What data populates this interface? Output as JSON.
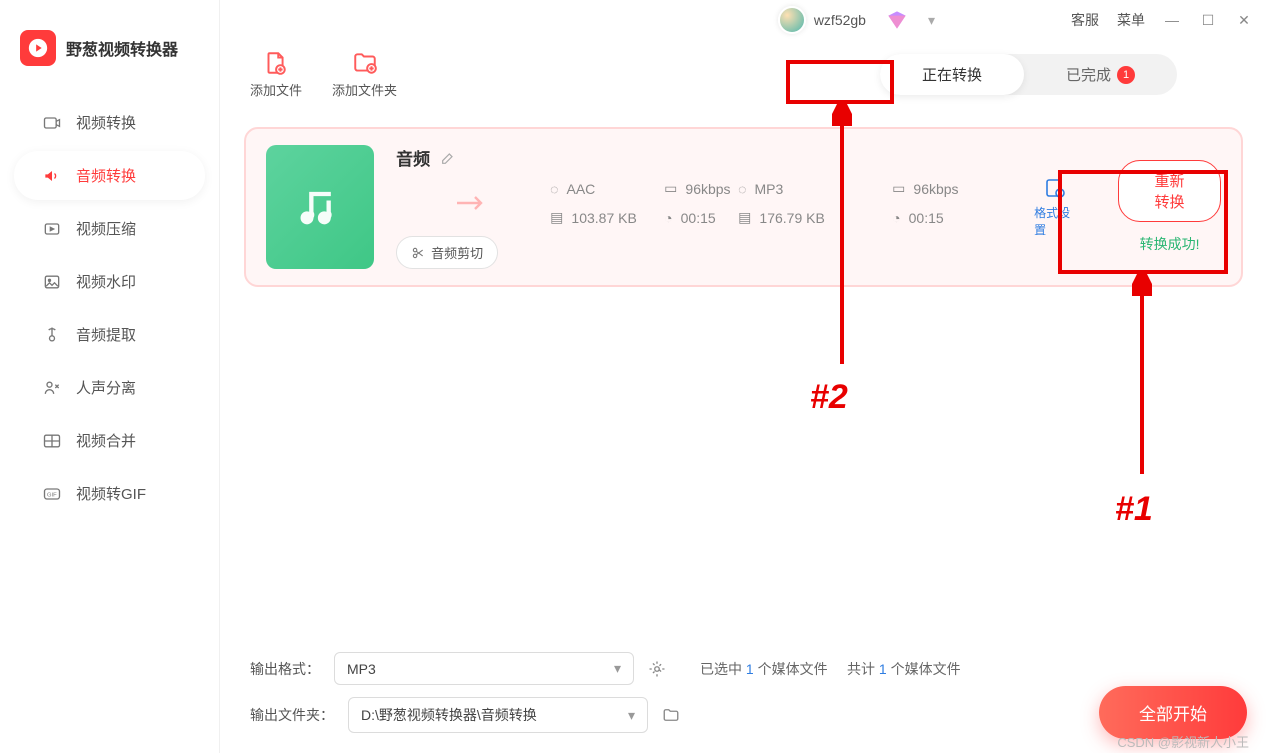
{
  "app": {
    "name": "野葱视频转换器"
  },
  "titlebar": {
    "username": "wzf52gb",
    "links": [
      "客服",
      "菜单"
    ]
  },
  "sidebar": {
    "items": [
      {
        "label": "视频转换",
        "icon": "video-convert-icon"
      },
      {
        "label": "音频转换",
        "icon": "audio-convert-icon",
        "active": true
      },
      {
        "label": "视频压缩",
        "icon": "video-compress-icon"
      },
      {
        "label": "视频水印",
        "icon": "watermark-icon"
      },
      {
        "label": "音频提取",
        "icon": "audio-extract-icon"
      },
      {
        "label": "人声分离",
        "icon": "voice-separate-icon"
      },
      {
        "label": "视频合并",
        "icon": "video-merge-icon"
      },
      {
        "label": "视频转GIF",
        "icon": "video-gif-icon"
      }
    ]
  },
  "toolbar": {
    "add_file": "添加文件",
    "add_folder": "添加文件夹",
    "tabs": {
      "converting": "正在转换",
      "completed": "已完成",
      "completed_count": "1"
    }
  },
  "item": {
    "title": "音频",
    "source": {
      "format": "AAC",
      "bitrate": "96kbps",
      "size": "103.87 KB",
      "duration": "00:15"
    },
    "target": {
      "format": "MP3",
      "bitrate": "96kbps",
      "size": "176.79 KB",
      "duration": "00:15"
    },
    "trim_label": "音频剪切",
    "format_settings": "格式设置",
    "reconvert": "重新转换",
    "success": "转换成功!"
  },
  "bottom": {
    "out_format_label": "输出格式：",
    "out_format_value": "MP3",
    "out_folder_label": "输出文件夹：",
    "out_folder_value": "D:\\野葱视频转换器\\音频转换",
    "selected_prefix": "已选中 ",
    "selected_count": "1",
    "selected_suffix": " 个媒体文件",
    "total_prefix": "共计 ",
    "total_count": "1",
    "total_suffix": " 个媒体文件",
    "start_all": "全部开始"
  },
  "annotations": {
    "label1": "#1",
    "label2": "#2"
  },
  "watermark": "CSDN @影视新人小王"
}
